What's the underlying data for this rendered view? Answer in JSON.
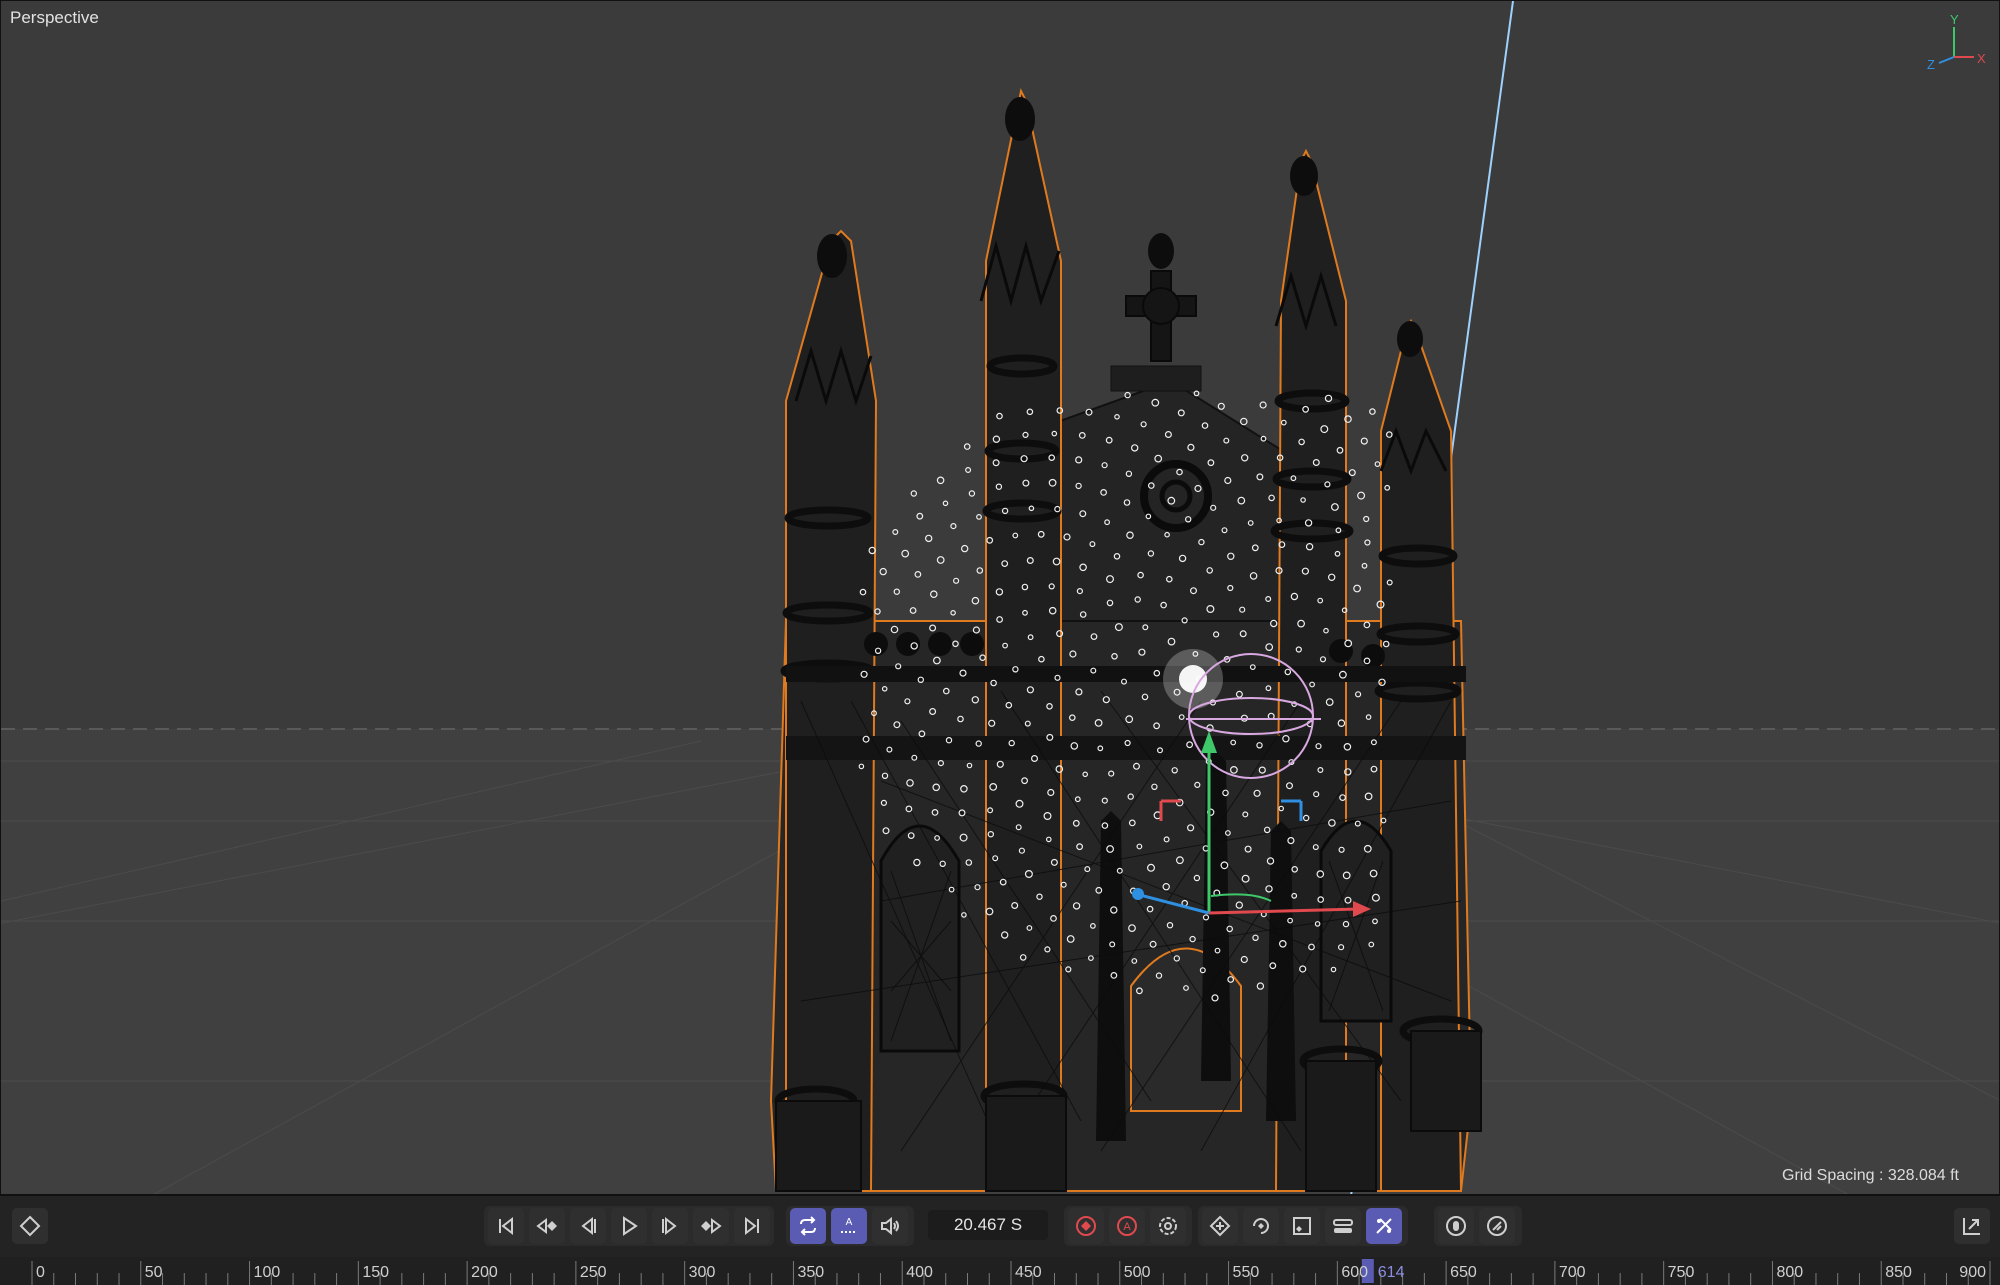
{
  "viewport": {
    "label": "Perspective",
    "grid_spacing": "Grid Spacing : 328.084 ft",
    "axis_gizmo": {
      "y": "Y",
      "x": "X",
      "z": "Z"
    }
  },
  "toolbar": {
    "keyframe_icon": "diamond-icon",
    "transport": [
      "go-to-start-icon",
      "prev-key-icon",
      "prev-frame-icon",
      "play-icon",
      "next-frame-icon",
      "next-key-icon",
      "go-to-end-icon"
    ],
    "loop_icon": "loop-icon",
    "autokey_label": "A",
    "audio_icon": "speaker-icon",
    "time_value": "20.467 S",
    "record_icons": [
      "record-key-icon",
      "auto-key-icon",
      "key-settings-icon"
    ],
    "key_tools": [
      "move-key-icon",
      "rotate-key-icon",
      "scale-key-icon",
      "param-key-icon",
      "pla-key-icon"
    ],
    "extra_tools": [
      "motion-path-icon",
      "onion-skin-icon"
    ],
    "right_icon": "timeline-expand-icon"
  },
  "timeline": {
    "start": 0,
    "end": 900,
    "current_frame": 614,
    "current_label": "614",
    "tick_labels": [
      "0",
      "50",
      "100",
      "150",
      "200",
      "250",
      "300",
      "350",
      "400",
      "450",
      "500",
      "550",
      "600",
      "650",
      "700",
      "750",
      "800",
      "850",
      "900"
    ]
  },
  "colors": {
    "viewport_bg": "#3b3b3b",
    "accent": "#5a5cb4",
    "selection_outline": "#e07a1f",
    "x_axis": "#e0494d",
    "y_axis": "#3ec86a",
    "z_axis": "#2f8fe0"
  }
}
